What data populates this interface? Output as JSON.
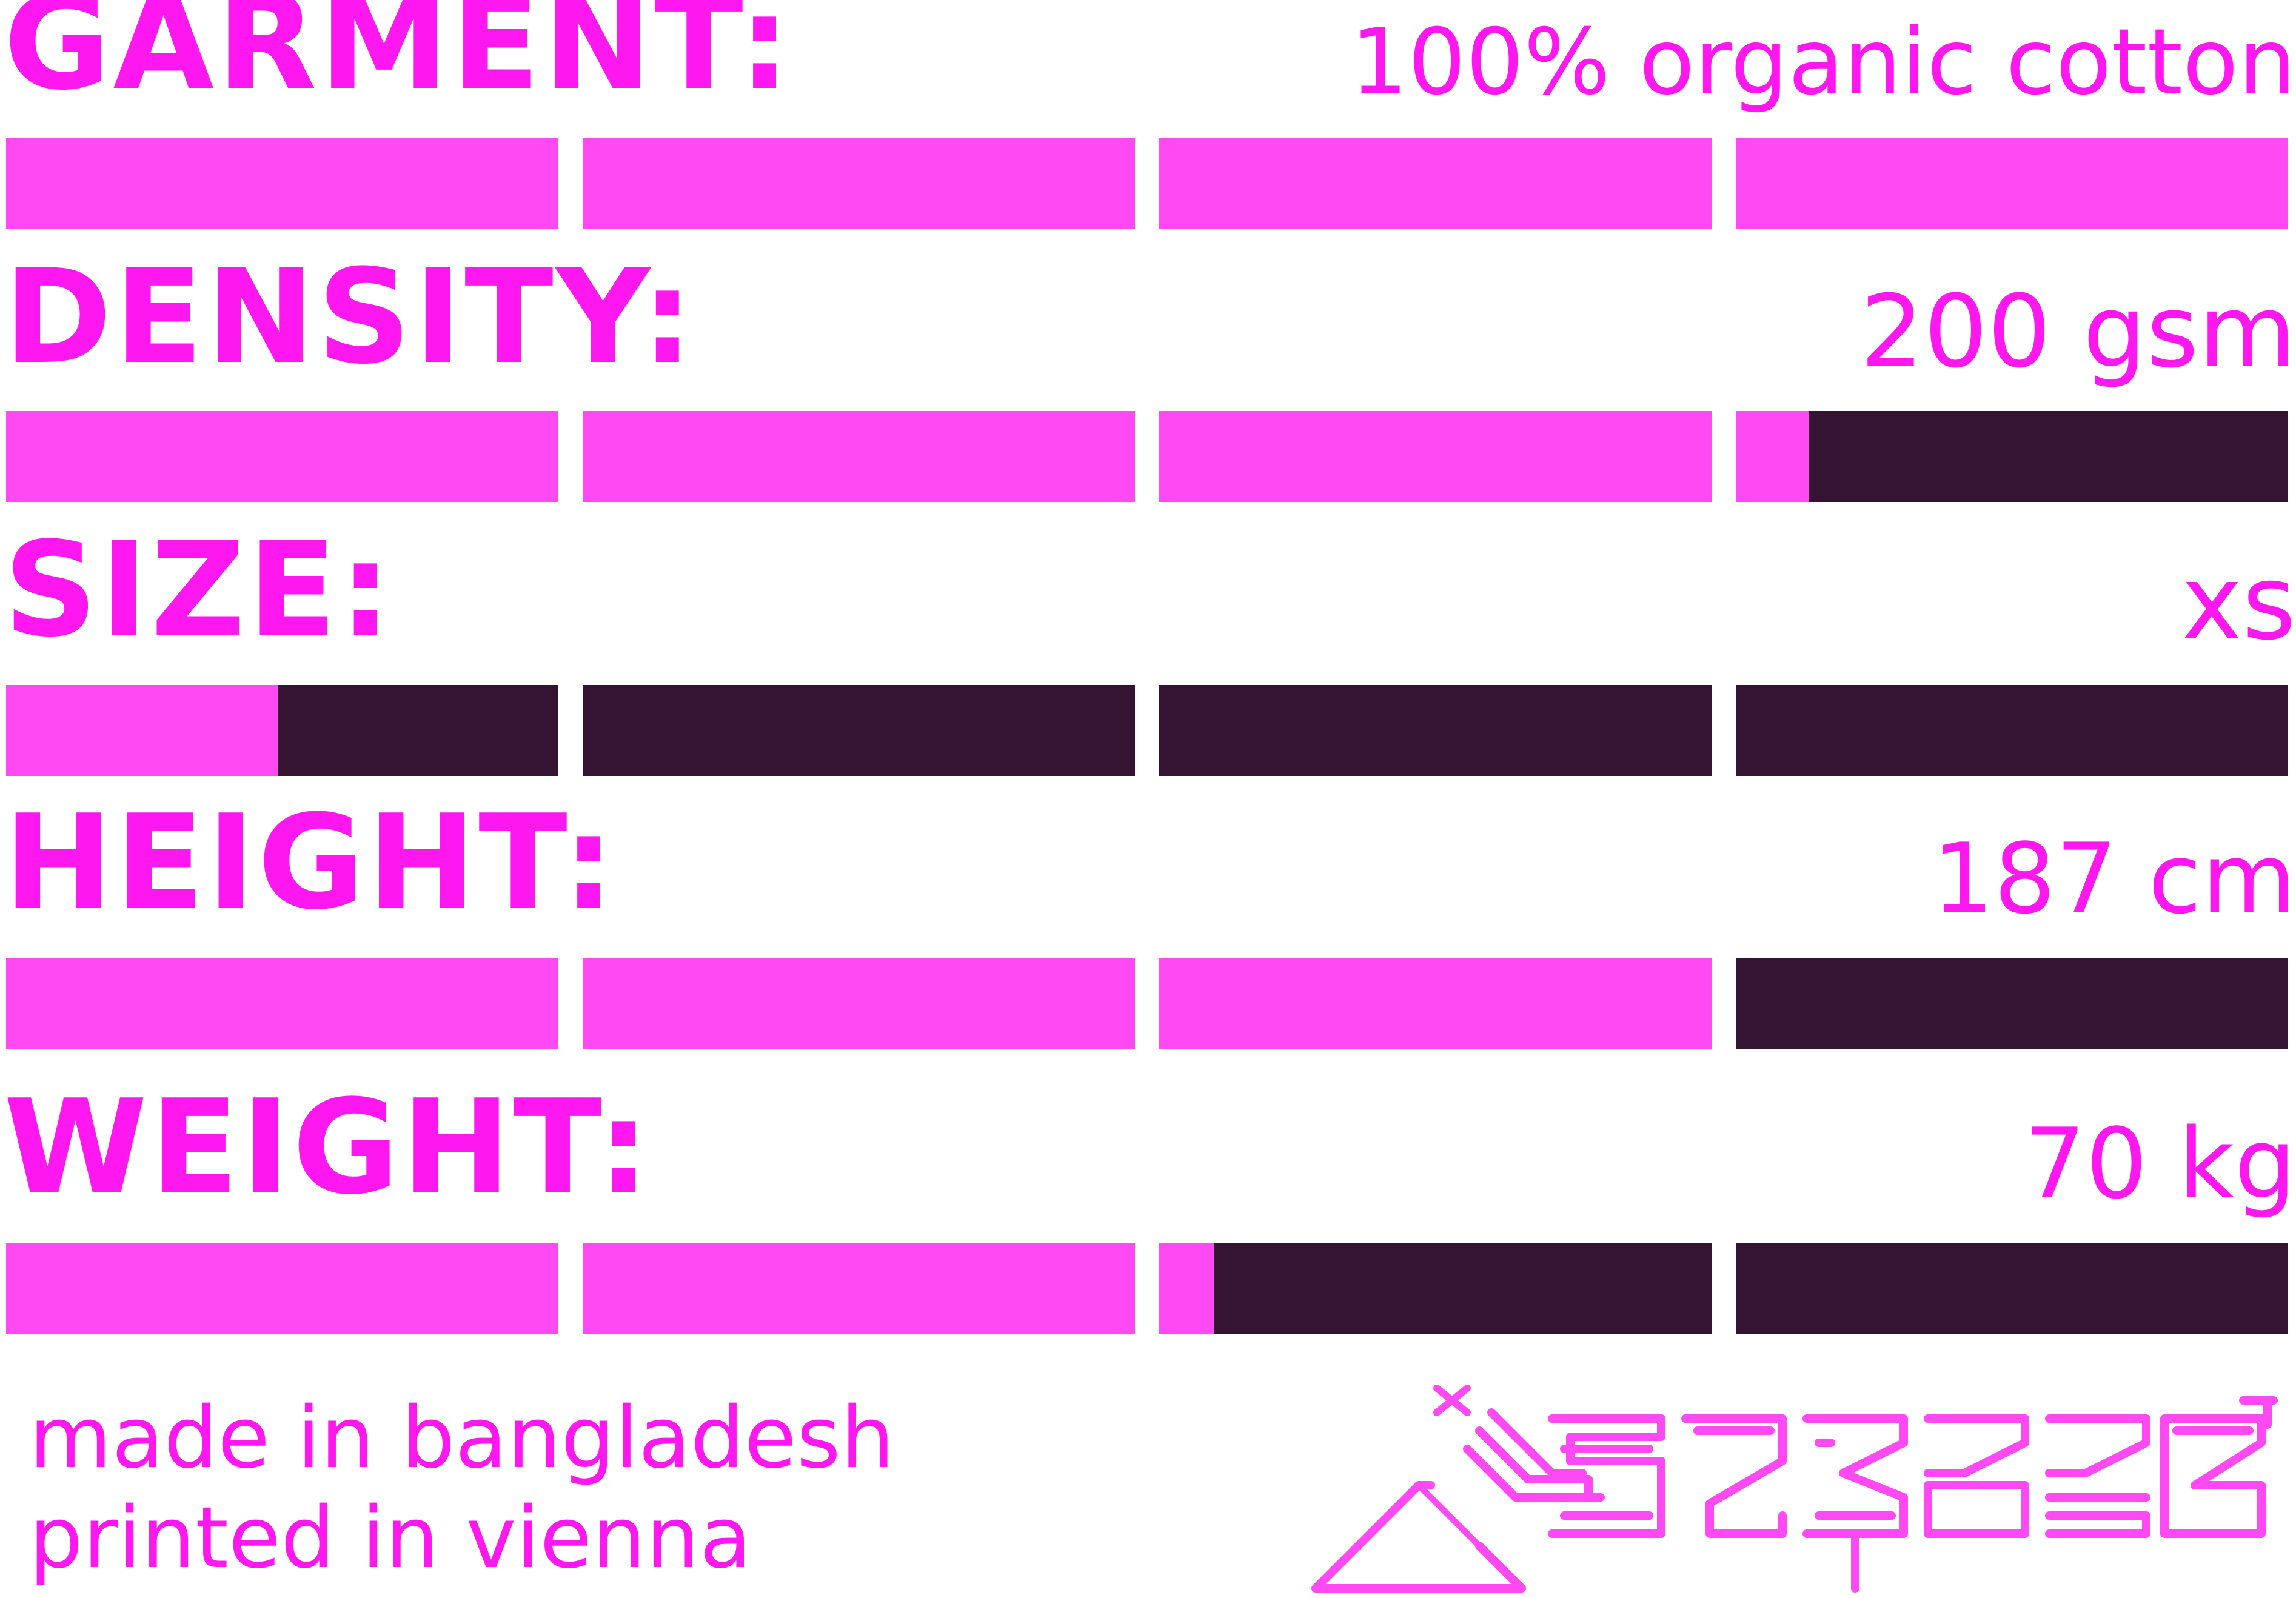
{
  "rows": [
    {
      "label": "GARMENT:",
      "value": "100% organic cotton",
      "level": 1.0
    },
    {
      "label": "DENSITY:",
      "value": "200 gsm",
      "level": 0.783
    },
    {
      "label": "SIZE:",
      "value": "xs",
      "level": 0.123
    },
    {
      "label": "HEIGHT:",
      "value": "187 cm",
      "level": 0.75
    },
    {
      "label": "WEIGHT:",
      "value": "70 kg",
      "level": 0.525
    }
  ],
  "footer": {
    "line1": "made in bangladesh",
    "line2": "printed in vienna"
  },
  "logo": {
    "name": "brand-logo"
  },
  "colors": {
    "magenta_text": "#ff17f0",
    "bar_fill": "#ff4af4",
    "bar_empty": "#351433",
    "bar_divider": "#2e3330",
    "background": "#ffffff"
  }
}
